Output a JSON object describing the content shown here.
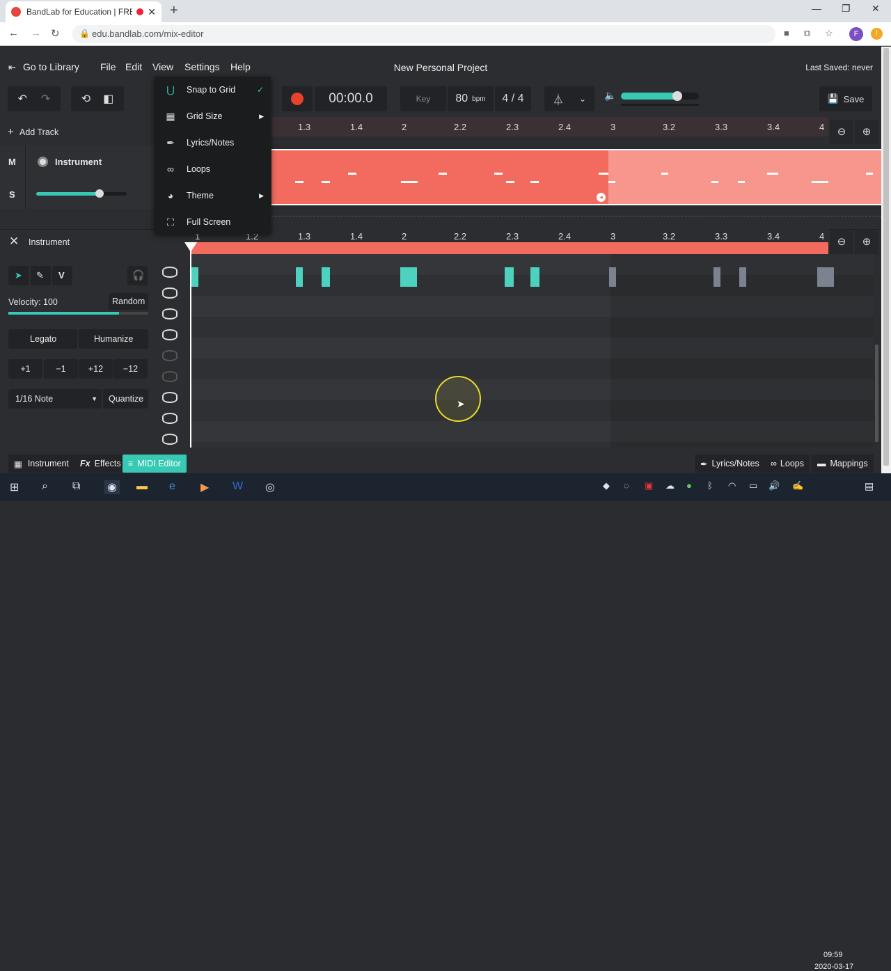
{
  "browser": {
    "tab_title": "BandLab for Education | FREE",
    "url": "edu.bandlab.com/mix-editor",
    "profile_initial": "F",
    "update_badge": "!"
  },
  "menu": {
    "go_to_library": "Go to Library",
    "file": "File",
    "edit": "Edit",
    "view": "View",
    "settings": "Settings",
    "help": "Help"
  },
  "project": {
    "title": "New Personal Project",
    "last_saved": "Last Saved: never"
  },
  "transport": {
    "time": "00:00.0",
    "key_label": "Key",
    "bpm_value": "80",
    "bpm_unit": "bpm",
    "time_signature": "4 / 4",
    "volume_fraction": 0.72,
    "save_label": "Save"
  },
  "view_menu": {
    "items": [
      {
        "label": "Snap to Grid",
        "icon": "magnet-icon",
        "checked": true
      },
      {
        "label": "Grid Size",
        "icon": "grid-icon",
        "submenu": true
      },
      {
        "label": "Lyrics/Notes",
        "icon": "feather-icon"
      },
      {
        "label": "Loops",
        "icon": "infinity-icon"
      },
      {
        "label": "Theme",
        "icon": "palette-icon",
        "submenu": true
      },
      {
        "label": "Full Screen",
        "icon": "fullscreen-icon"
      }
    ]
  },
  "track": {
    "add_track": "Add Track",
    "mute": "M",
    "solo": "S",
    "name": "Instrument",
    "volume_fraction": 0.7
  },
  "ruler_top": [
    "1.3",
    "1.4",
    "2",
    "2.2",
    "2.3",
    "2.4",
    "3",
    "3.2",
    "3.3",
    "3.4",
    "4"
  ],
  "ruler_bottom": [
    "1",
    "1.2",
    "1.3",
    "1.4",
    "2",
    "2.2",
    "2.3",
    "2.4",
    "3",
    "3.2",
    "3.3",
    "3.4",
    "4"
  ],
  "editor": {
    "title": "Instrument",
    "velocity_label": "Velocity: 100",
    "random_label": "Random",
    "velocity_fraction": 0.79,
    "legato": "Legato",
    "humanize": "Humanize",
    "transpose": [
      "+1",
      "−1",
      "+12",
      "−12"
    ],
    "note_value": "1/16 Note",
    "quantize": "Quantize",
    "tool_v": "V"
  },
  "bottom_tabs": {
    "instrument": "Instrument",
    "effects_fx": "Fx",
    "effects": "Effects",
    "midi_editor": "MIDI Editor",
    "lyrics_notes": "Lyrics/Notes",
    "loops": "Loops",
    "mappings": "Mappings"
  },
  "colors": {
    "accent": "#37c9b4",
    "region": "#f26b5e",
    "record": "#e8412c"
  },
  "taskbar": {
    "time": "09:59",
    "date": "2020-03-17"
  }
}
